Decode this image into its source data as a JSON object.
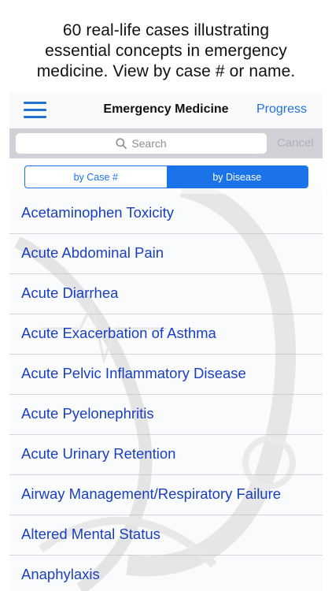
{
  "caption": {
    "line1": "60 real-life cases illustrating",
    "line2": "essential concepts in emergency",
    "line3": "medicine. View by case # or name."
  },
  "navbar": {
    "title": "Emergency Medicine",
    "right_button": "Progress",
    "menu_icon": "hamburger-menu-icon"
  },
  "search": {
    "placeholder": "Search",
    "cancel_label": "Cancel",
    "icon": "search-icon"
  },
  "segments": {
    "by_case": "by Case #",
    "by_disease": "by Disease",
    "selected": "by Disease"
  },
  "list": {
    "items": [
      "Acetaminophen Toxicity",
      "Acute Abdominal Pain",
      "Acute Diarrhea",
      "Acute Exacerbation of Asthma",
      "Acute Pelvic Inflammatory Disease",
      "Acute Pyelonephritis",
      "Acute Urinary Retention",
      "Airway Management/Respiratory Failure",
      "Altered Mental Status",
      "Anaphylaxis"
    ]
  },
  "colors": {
    "accent": "#1a73e8",
    "link_text": "#1a3fbe",
    "caption_text": "#111111"
  }
}
